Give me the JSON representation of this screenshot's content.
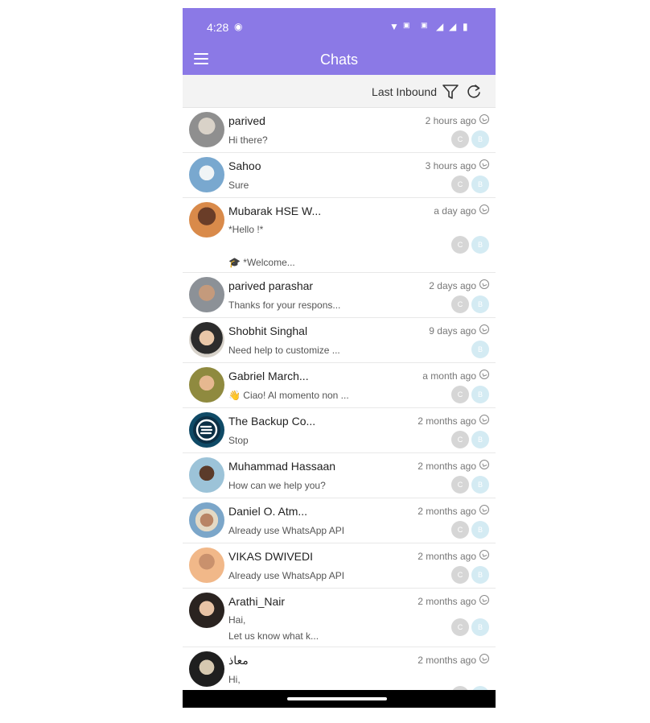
{
  "status_bar": {
    "time": "4:28"
  },
  "app_bar": {
    "title": "Chats"
  },
  "filter_bar": {
    "label": "Last Inbound"
  },
  "colors": {
    "accent": "#8b79e6",
    "chip_c": "#d6d6d6",
    "chip_b": "#d4ebf3"
  },
  "chats": [
    {
      "name": "parived",
      "time": "2 hours ago",
      "preview": "Hi there?",
      "chips": [
        "C",
        "B"
      ]
    },
    {
      "name": "Sahoo",
      "time": "3 hours ago",
      "preview": "Sure",
      "chips": [
        "C",
        "B"
      ]
    },
    {
      "name": "Mubarak HSE W...",
      "time": "a day ago",
      "preview": "*Hello !*",
      "preview2": "🎓 *Welcome...",
      "chips": [
        "C",
        "B"
      ]
    },
    {
      "name": "parived parashar",
      "time": "2 days ago",
      "preview": "Thanks for your respons...",
      "chips": [
        "C",
        "B"
      ]
    },
    {
      "name": "Shobhit Singhal",
      "time": "9 days ago",
      "preview": "Need help to customize ...",
      "chips": [
        "B"
      ]
    },
    {
      "name": "Gabriel March...",
      "time": "a month ago",
      "preview": "👋 Ciao! Al momento non ...",
      "chips": [
        "C",
        "B"
      ]
    },
    {
      "name": "The Backup Co...",
      "time": "2 months ago",
      "preview": "Stop",
      "chips": [
        "C",
        "B"
      ]
    },
    {
      "name": "Muhammad Hassaan",
      "time": "2 months ago",
      "preview": "How can we help you?",
      "chips": [
        "C",
        "B"
      ]
    },
    {
      "name": "Daniel O. Atm...",
      "time": "2 months ago",
      "preview": "Already use WhatsApp API",
      "chips": [
        "C",
        "B"
      ]
    },
    {
      "name": "VIKAS DWIVEDI",
      "time": "2 months ago",
      "preview": "Already use WhatsApp API",
      "chips": [
        "C",
        "B"
      ]
    },
    {
      "name": "Arathi_Nair",
      "time": "2 months ago",
      "preview": "Hai,",
      "preview2": "Let us know what k...",
      "chips": [
        "C",
        "B"
      ]
    },
    {
      "name": "معاذ",
      "time": "2 months ago",
      "preview": "Hi,",
      "chips": [
        "C",
        "B"
      ]
    }
  ]
}
